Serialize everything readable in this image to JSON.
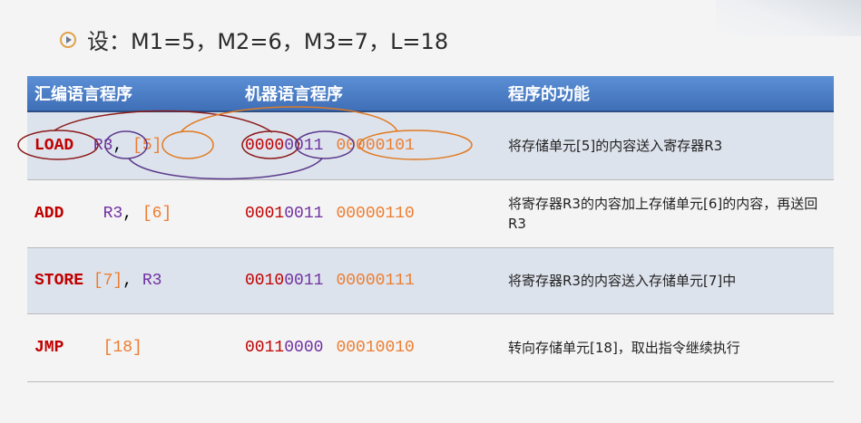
{
  "title": "设：M1=5，M2=6，M3=7，L=18",
  "headers": [
    "汇编语言程序",
    "机器语言程序",
    "程序的功能"
  ],
  "rows": [
    {
      "op": "LOAD",
      "sep1": "  ",
      "arg1": "R3",
      "comma": ", ",
      "arg2": "[5]",
      "arg1_class": "reg",
      "arg2_class": "mem",
      "bits_op": "0000",
      "bits_reg": "0011",
      "bits_mem": "00000101",
      "func": "将存储单元[5]的内容送入寄存器R3"
    },
    {
      "op": "ADD",
      "sep1": "    ",
      "arg1": "R3",
      "comma": ", ",
      "arg2": "[6]",
      "arg1_class": "reg",
      "arg2_class": "mem",
      "bits_op": "0001",
      "bits_reg": "0011",
      "bits_mem": "00000110",
      "func": "将寄存器R3的内容加上存储单元[6]的内容，再送回R3"
    },
    {
      "op": "STORE",
      "sep1": " ",
      "arg1": "[7]",
      "comma": ", ",
      "arg2": "R3",
      "arg1_class": "mem",
      "arg2_class": "reg",
      "bits_op": "0010",
      "bits_reg": "0011",
      "bits_mem": "00000111",
      "func": "将寄存器R3的内容送入存储单元[7]中"
    },
    {
      "op": "JMP",
      "sep1": "    ",
      "arg1": "[18]",
      "comma": "",
      "arg2": "",
      "arg1_class": "mem",
      "arg2_class": "mem",
      "bits_op": "0011",
      "bits_reg": "0000",
      "bits_mem": "00010010",
      "func": "转向存储单元[18]，取出指令继续执行"
    }
  ],
  "colors": {
    "opcode": "#c00000",
    "register": "#7030a0",
    "memory": "#ed7d31",
    "header_bg": "#4a7cc4"
  }
}
